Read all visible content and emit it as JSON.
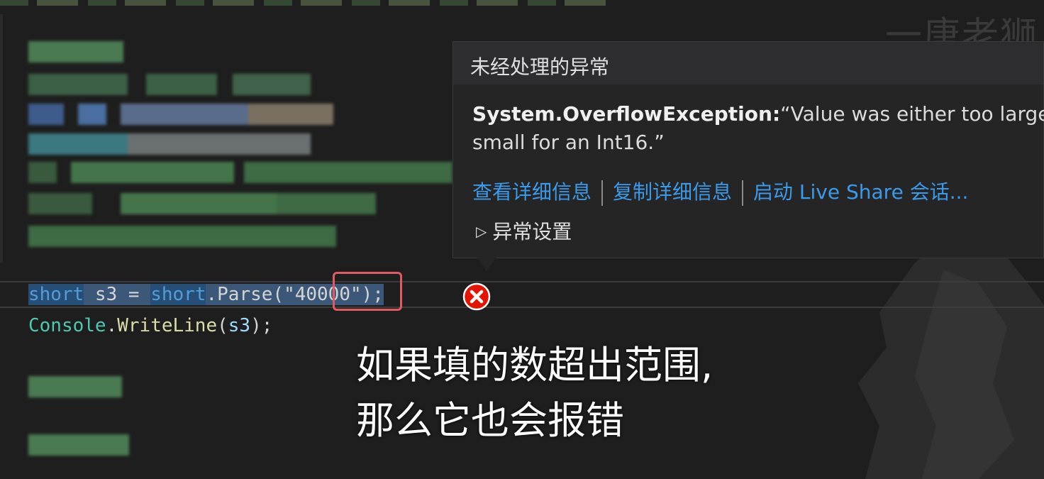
{
  "watermark": "一唐老狮",
  "popup": {
    "title": "未经处理的异常",
    "exception_name": "System.OverflowException:",
    "exception_message": "“Value was either too large or too",
    "exception_message_line2": "small for an Int16.”",
    "links": [
      "查看详细信息",
      "复制详细信息",
      "启动 Live Share 会话..."
    ],
    "settings_label": "异常设置"
  },
  "code": {
    "line1": {
      "type_kw": "short",
      "var": " s3 = ",
      "type_kw2": "short",
      "call": ".Parse(",
      "quote_open": "\"",
      "literal": "40000",
      "quote_close": "\"",
      "end": ");"
    },
    "line2": {
      "cls": "Console",
      "dot": ".",
      "method": "WriteLine",
      "args_open": "(",
      "arg": "s3",
      "args_close": ");"
    }
  },
  "subtitle": {
    "line1": "如果填的数超出范围,",
    "line2": "那么它也会报错"
  },
  "colors": {
    "accent_link": "#3b9bea",
    "error_red": "#e51400",
    "highlight_box": "#e05a63"
  },
  "icons": {
    "error": "error-circle-x-icon",
    "expand": "triangle-right-icon"
  }
}
